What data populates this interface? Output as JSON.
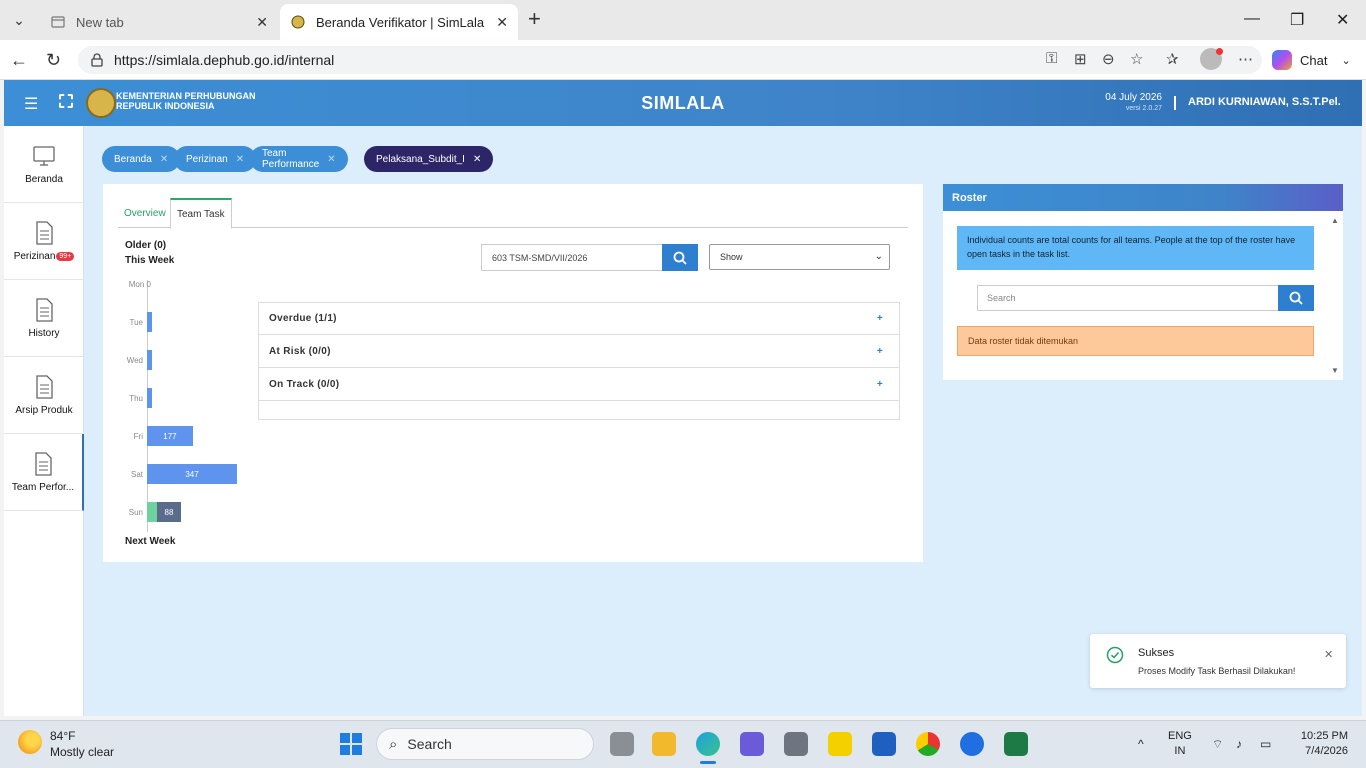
{
  "browser": {
    "tabs": [
      {
        "title": "New tab"
      },
      {
        "title": "Beranda Verifikator | SimLala"
      }
    ],
    "url": "https://simlala.dephub.go.id/internal",
    "chat_label": "Chat"
  },
  "header": {
    "org_line1": "KEMENTERIAN PERHUBUNGAN",
    "org_line2": "REPUBLIK INDONESIA",
    "title": "SIMLALA",
    "date": "04 July 2026",
    "version": "versi 2.0.27",
    "user": "ARDI KURNIAWAN, S.S.T.Pel."
  },
  "sidebar": {
    "items": [
      {
        "label": "Beranda"
      },
      {
        "label": "Perizinan",
        "badge": "99+"
      },
      {
        "label": "History"
      },
      {
        "label": "Arsip Produk"
      },
      {
        "label": "Team Perfor..."
      }
    ]
  },
  "breadcrumbs": [
    {
      "label": "Beranda"
    },
    {
      "label": "Perizinan"
    },
    {
      "label": "Team Performance"
    },
    {
      "label": "Pelaksana_Subdit_I"
    }
  ],
  "main": {
    "tabs": [
      {
        "label": "Overview"
      },
      {
        "label": "Team Task"
      }
    ],
    "older_label": "Older (0)",
    "this_week_label": "This Week",
    "next_week_label": "Next Week",
    "search_value": "603 TSM-SMD/VII/2026",
    "show_select": "Show",
    "accordion": [
      {
        "label": "Overdue (1/1)"
      },
      {
        "label": "At Risk (0/0)"
      },
      {
        "label": "On Track (0/0)"
      }
    ]
  },
  "chart_data": {
    "type": "bar",
    "categories": [
      "Mon",
      "Tue",
      "Wed",
      "Thu",
      "Fri",
      "Sat",
      "Sun"
    ],
    "series": [
      {
        "values": [
          0,
          0,
          0,
          0,
          177,
          347,
          88
        ]
      }
    ],
    "sun_split": {
      "green": 0,
      "dark": 88
    },
    "mon_label": "Mon 0"
  },
  "roster": {
    "title": "Roster",
    "info": "Individual counts are total counts for all teams. People at the top of the roster have open tasks in the task list.",
    "search_placeholder": "Search",
    "empty_message": "Data roster tidak ditemukan"
  },
  "toast": {
    "title": "Sukses",
    "message": "Proses Modify Task Berhasil Dilakukan!"
  },
  "taskbar": {
    "temperature": "84°F",
    "weather": "Mostly clear",
    "search_label": "Search",
    "lang1": "ENG",
    "lang2": "IN",
    "time": "10:25 PM",
    "date": "7/4/2026"
  },
  "colors": {
    "accent": "#3c8fd6",
    "active_crumb": "#2c2668",
    "bar": "#5f94ee",
    "success": "#28a064"
  }
}
